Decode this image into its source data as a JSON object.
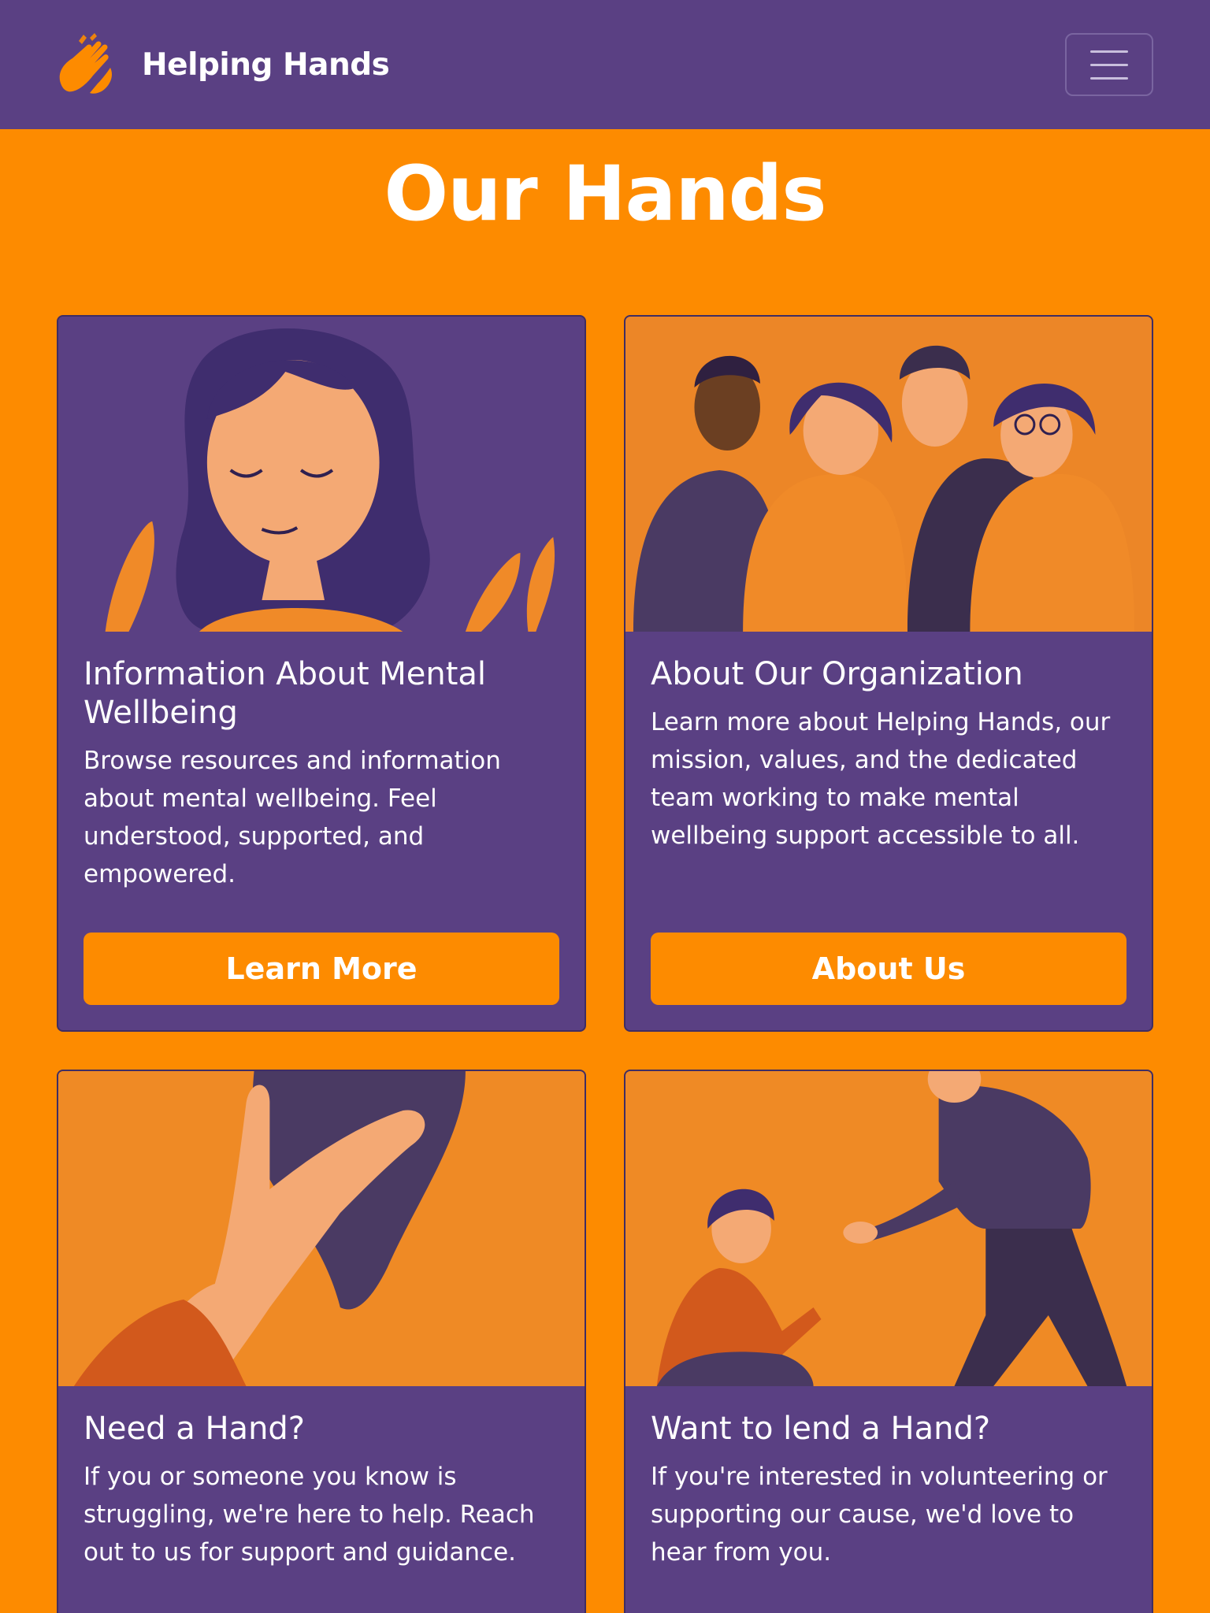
{
  "nav": {
    "brand_name": "Helping Hands",
    "logo_icon": "raised-hands-icon",
    "menu_icon": "hamburger-menu-icon"
  },
  "page": {
    "title": "Our Hands"
  },
  "colors": {
    "primary": "#5a4083",
    "accent": "#fd8b00",
    "text": "#ffffff"
  },
  "cards": [
    {
      "title": "Information About Mental Wellbeing",
      "text": "Browse resources and information about mental wellbeing. Feel understood, supported, and empowered.",
      "button": "Learn More",
      "image": "calm-woman-illustration"
    },
    {
      "title": "About Our Organization",
      "text": "Learn more about Helping Hands, our mission, values, and the dedicated team working to make mental wellbeing support accessible to all.",
      "button": "About Us",
      "image": "team-group-illustration"
    },
    {
      "title": "Need a Hand?",
      "text": "If you or someone you know is struggling, we're here to help. Reach out to us for support and guidance.",
      "image": "hands-holding-illustration"
    },
    {
      "title": "Want to lend a Hand?",
      "text": "If you're interested in volunteering or supporting our cause, we'd love to hear from you.",
      "image": "helping-up-illustration"
    }
  ]
}
